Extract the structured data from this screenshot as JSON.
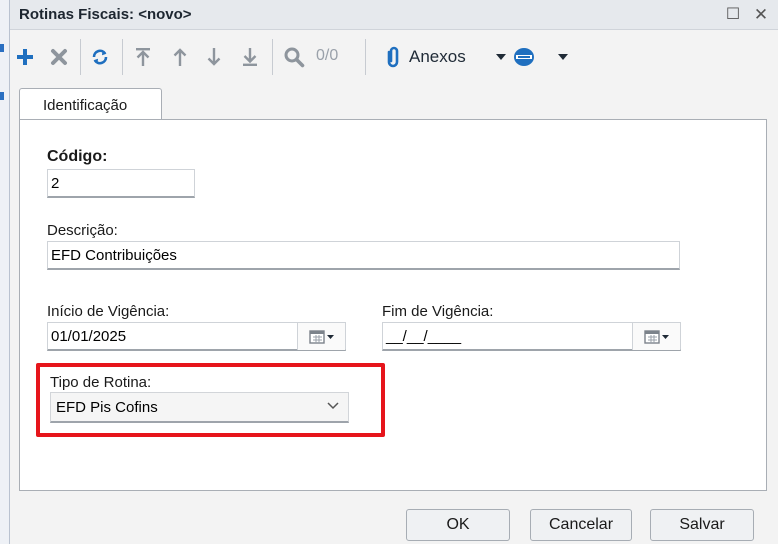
{
  "window": {
    "title": "Rotinas Fiscais: <novo>",
    "maximize_glyph": "☐",
    "close_glyph": "✕"
  },
  "toolbar": {
    "counter": "0/0",
    "attachments_label": "Anexos",
    "icons": [
      "plus-icon",
      "delete-icon",
      "refresh-icon",
      "first-record-icon",
      "previous-record-icon",
      "next-record-icon",
      "last-record-icon",
      "search-icon",
      "paperclip-icon",
      "dropdown-arrow-icon",
      "database-icon",
      "dropdown-arrow-icon"
    ]
  },
  "tabs": [
    {
      "label": "Identificação",
      "active": true
    }
  ],
  "form": {
    "codigo": {
      "label": "Código:",
      "value": "2"
    },
    "descricao": {
      "label": "Descrição:",
      "value": "EFD Contribuições"
    },
    "inicio_vigencia": {
      "label": "Início de Vigência:",
      "value": "01/01/2025"
    },
    "fim_vigencia": {
      "label": "Fim de Vigência:",
      "value": "__/__/____"
    },
    "tipo_rotina": {
      "label": "Tipo de Rotina:",
      "value": "EFD Pis Cofins"
    }
  },
  "buttons": {
    "ok": "OK",
    "cancel": "Cancelar",
    "save": "Salvar"
  },
  "colors": {
    "accent_blue": "#1f6fbf",
    "highlight_red": "#e6151b"
  }
}
